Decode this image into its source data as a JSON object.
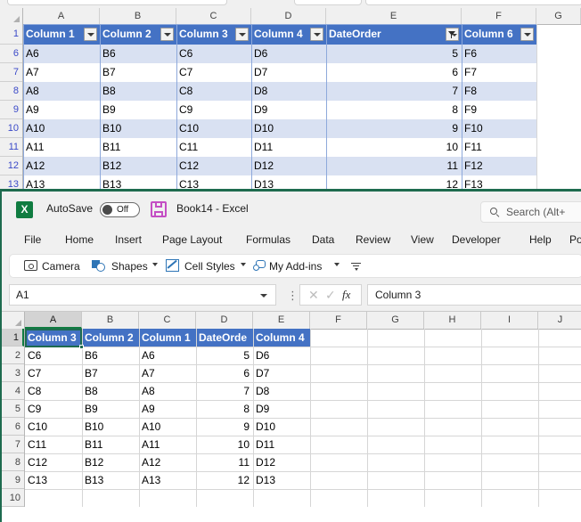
{
  "top_window": {
    "name": "clipped-spreadsheet-view",
    "column_letters": [
      "A",
      "B",
      "C",
      "D",
      "E",
      "F",
      "G"
    ],
    "row_numbers": [
      "1",
      "6",
      "7",
      "8",
      "9",
      "10",
      "11",
      "12",
      "13"
    ],
    "table_headers": [
      "Column 1",
      "Column 2",
      "Column 3",
      "Column 4",
      "DateOrder",
      "Column 6"
    ],
    "header_filter_icons": [
      "filter-dropdown-icon",
      "filter-dropdown-icon",
      "filter-dropdown-icon",
      "filter-dropdown-icon",
      "filter-applied-icon",
      "filter-dropdown-icon"
    ],
    "rows": [
      {
        "row": "6",
        "cells": [
          "A6",
          "B6",
          "C6",
          "D6",
          "5",
          "F6"
        ]
      },
      {
        "row": "7",
        "cells": [
          "A7",
          "B7",
          "C7",
          "D7",
          "6",
          "F7"
        ]
      },
      {
        "row": "8",
        "cells": [
          "A8",
          "B8",
          "C8",
          "D8",
          "7",
          "F8"
        ]
      },
      {
        "row": "9",
        "cells": [
          "A9",
          "B9",
          "C9",
          "D9",
          "8",
          "F9"
        ]
      },
      {
        "row": "10",
        "cells": [
          "A10",
          "B10",
          "C10",
          "D10",
          "9",
          "F10"
        ]
      },
      {
        "row": "11",
        "cells": [
          "A11",
          "B11",
          "C11",
          "D11",
          "10",
          "F11"
        ]
      },
      {
        "row": "12",
        "cells": [
          "A12",
          "B12",
          "C12",
          "D12",
          "11",
          "F12"
        ]
      },
      {
        "row": "13",
        "cells": [
          "A13",
          "B13",
          "C13",
          "D13",
          "12",
          "F13"
        ]
      }
    ],
    "colors": {
      "table_header_fill": "#4472C4",
      "banded_row_fill": "#D9E1F2",
      "table_border": "#8EA9DB",
      "filtered_row_number": "#3A49C8"
    }
  },
  "excel_window": {
    "title_bar": {
      "app_icon": "excel-logo-icon",
      "autosave_label": "AutoSave",
      "autosave_state": "Off",
      "save_icon": "save-icon",
      "document_title": "Book14  -  Excel",
      "search_icon": "search-icon",
      "search_placeholder": "Search (Alt+"
    },
    "ribbon_tabs": [
      "File",
      "Home",
      "Insert",
      "Page Layout",
      "Formulas",
      "Data",
      "Review",
      "View",
      "Developer",
      "Help",
      "Pow"
    ],
    "quick_toolbar": [
      {
        "label": "Camera",
        "icon": "camera-icon",
        "has_chevron": false
      },
      {
        "label": "Shapes",
        "icon": "shapes-icon",
        "has_chevron": true
      },
      {
        "label": "Cell Styles",
        "icon": "cell-styles-icon",
        "has_chevron": true
      },
      {
        "label": "My Add-ins",
        "icon": "add-ins-icon",
        "has_chevron": true
      }
    ],
    "overflow_icon": "more-commands-icon",
    "formula_bar": {
      "name_box_value": "A1",
      "name_box_chevron": "chevron-down-icon",
      "cancel_icon": "cancel-icon",
      "enter_icon": "enter-icon",
      "function_icon": "fx-icon",
      "formula_value": "Column 3"
    },
    "grid": {
      "column_letters": [
        "A",
        "B",
        "C",
        "D",
        "E",
        "F",
        "G",
        "H",
        "I",
        "J"
      ],
      "selected_column": "A",
      "row_numbers": [
        "1",
        "2",
        "3",
        "4",
        "5",
        "6",
        "7",
        "8",
        "9",
        "10"
      ],
      "selected_row": "1",
      "selected_cell": "A1",
      "header_row": [
        "Column 3",
        "Column 2",
        "Column 1",
        "DateOrde",
        "Column 4"
      ],
      "rows": [
        {
          "row": "2",
          "cells": [
            "C6",
            "B6",
            "A6",
            "5",
            "D6"
          ]
        },
        {
          "row": "3",
          "cells": [
            "C7",
            "B7",
            "A7",
            "6",
            "D7"
          ]
        },
        {
          "row": "4",
          "cells": [
            "C8",
            "B8",
            "A8",
            "7",
            "D8"
          ]
        },
        {
          "row": "5",
          "cells": [
            "C9",
            "B9",
            "A9",
            "8",
            "D9"
          ]
        },
        {
          "row": "6",
          "cells": [
            "C10",
            "B10",
            "A10",
            "9",
            "D10"
          ]
        },
        {
          "row": "7",
          "cells": [
            "C11",
            "B11",
            "A11",
            "10",
            "D11"
          ]
        },
        {
          "row": "8",
          "cells": [
            "C12",
            "B12",
            "A12",
            "11",
            "D12"
          ]
        },
        {
          "row": "9",
          "cells": [
            "C13",
            "B13",
            "A13",
            "12",
            "D13"
          ]
        },
        {
          "row": "10",
          "cells": [
            "",
            "",
            "",
            "",
            ""
          ]
        }
      ],
      "colors": {
        "header_fill": "#4472C4",
        "selection_border": "#1E6B4F"
      }
    }
  }
}
